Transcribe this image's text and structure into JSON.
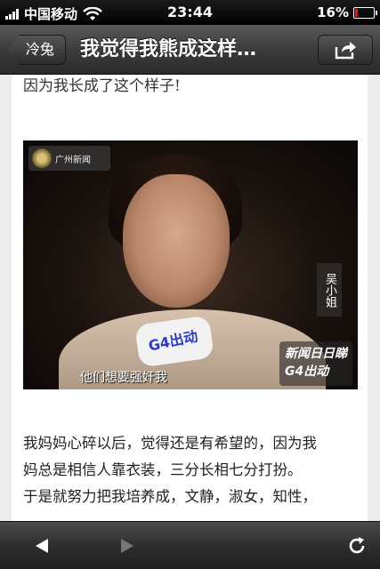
{
  "status_bar": {
    "carrier": "中国移动",
    "time": "23:44",
    "battery": "16%",
    "battery_level": 0.16,
    "signal_bars": 4
  },
  "nav_bar": {
    "back_label": "冷兔",
    "title": "我觉得我熊成这样…",
    "share_icon": "share-icon"
  },
  "article": {
    "intro_line": "因为我长成了这个样子!",
    "image": {
      "channel_logo": "广州新闻",
      "mic_label": "G4出动",
      "name_tag": "吴小姐",
      "corner_logo_line1": "新闻日日睇",
      "corner_logo_line2": "G4出动",
      "subtitle": "他们想要强奸我"
    },
    "paragraph": [
      "我妈妈心碎以后，觉得还是有希望的，因为我",
      "妈总是相信人靠衣装，三分长相七分打扮。",
      "于是就努力把我培养成，文静，淑女，知性，"
    ]
  },
  "toolbar": {
    "back_icon": "back-arrow-icon",
    "forward_icon": "forward-arrow-icon",
    "refresh_icon": "refresh-icon"
  }
}
